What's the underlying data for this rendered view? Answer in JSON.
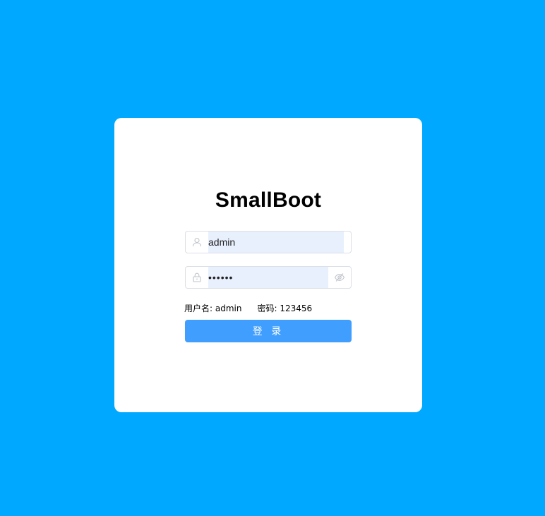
{
  "app": {
    "title": "SmallBoot"
  },
  "form": {
    "username": {
      "value": "admin",
      "icon": "user-icon"
    },
    "password": {
      "value": "123456",
      "icon": "lock-icon",
      "toggle_icon": "eye-hidden-icon"
    },
    "hint": {
      "username_text": "用户名: admin",
      "password_text": "密码: 123456"
    },
    "login_label": "登 录"
  },
  "colors": {
    "background": "#00a8ff",
    "card": "#ffffff",
    "button": "#409eff",
    "autofill": "#e8f0fe",
    "border": "#dcdfe6"
  }
}
